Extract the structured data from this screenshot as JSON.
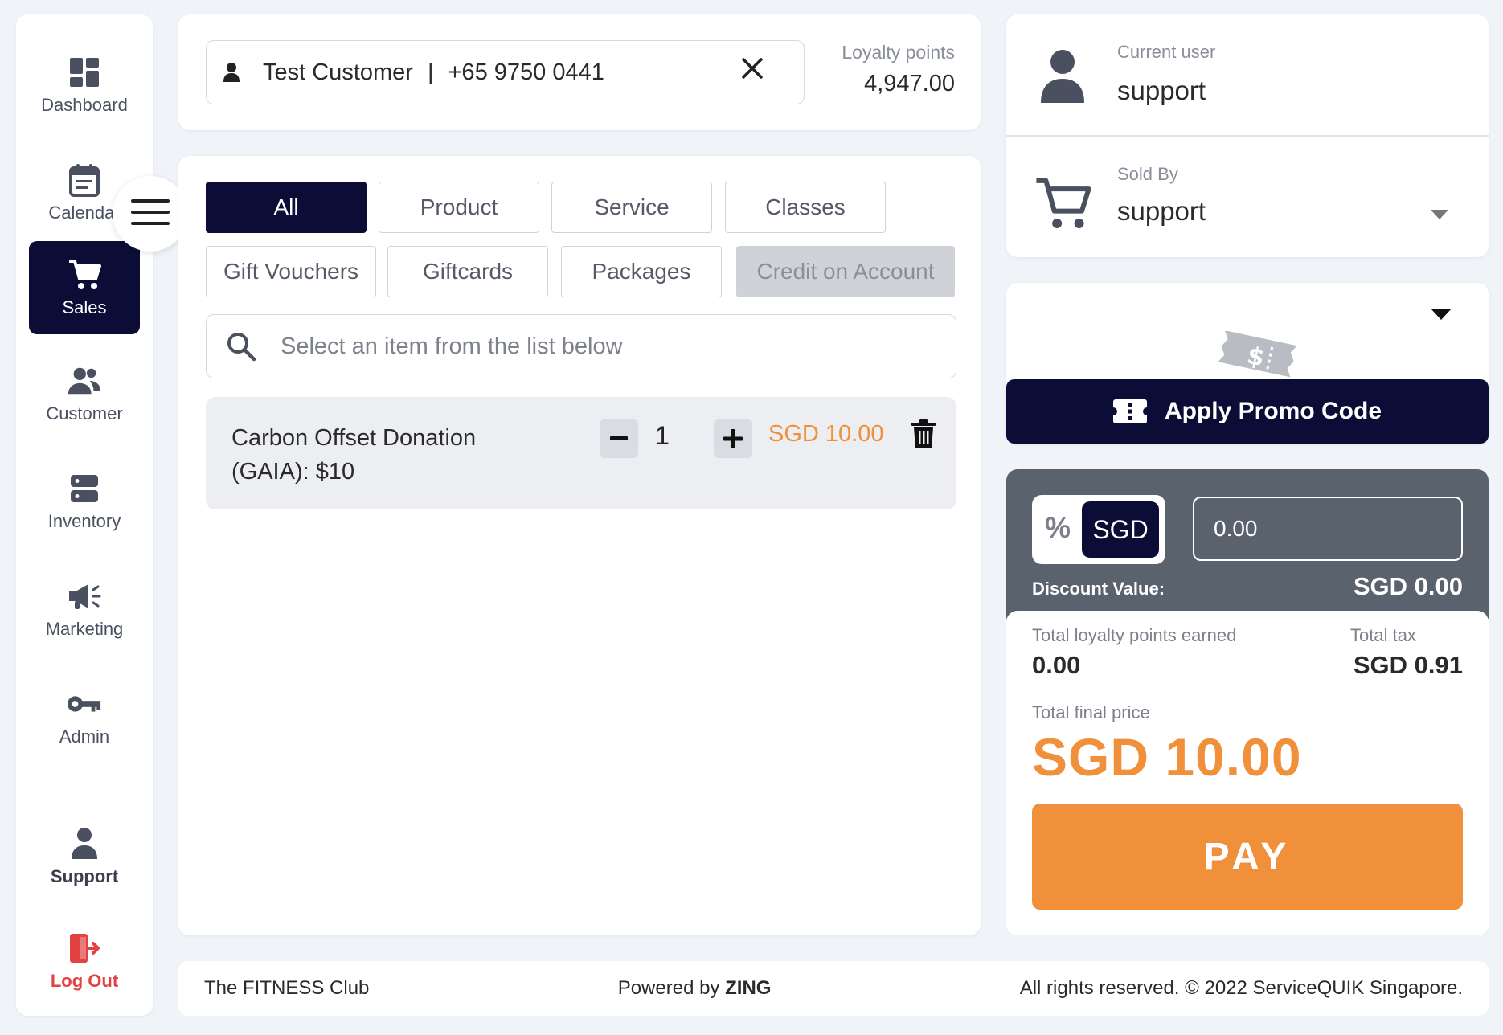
{
  "sidebar": {
    "items": [
      {
        "label": "Dashboard",
        "icon": "dashboard-icon"
      },
      {
        "label": "Calendar",
        "icon": "calendar-icon"
      },
      {
        "label": "Sales",
        "icon": "cart-icon"
      },
      {
        "label": "Customer",
        "icon": "users-icon"
      },
      {
        "label": "Inventory",
        "icon": "server-icon"
      },
      {
        "label": "Marketing",
        "icon": "megaphone-icon"
      },
      {
        "label": "Admin",
        "icon": "key-icon"
      }
    ],
    "support_label": "Support",
    "logout_label": "Log Out"
  },
  "customer": {
    "name": "Test Customer",
    "separator": "|",
    "phone": "+65 9750 0441",
    "loyalty_label": "Loyalty points",
    "loyalty_value": "4,947.00"
  },
  "tabs": [
    "All",
    "Product",
    "Service",
    "Classes",
    "Gift Vouchers",
    "Giftcards",
    "Packages",
    "Credit on Account"
  ],
  "search": {
    "placeholder": "Select an item from the list below"
  },
  "cart": {
    "item_name": "Carbon Offset Donation (GAIA): $10",
    "quantity": "1",
    "price": "SGD 10.00"
  },
  "user_panel": {
    "current_user_label": "Current user",
    "current_user": "support",
    "sold_by_label": "Sold By",
    "sold_by": "support"
  },
  "promo": {
    "button_label": "Apply Promo Code"
  },
  "summary": {
    "percent_symbol": "%",
    "currency_toggle": "SGD",
    "discount_input": "0.00",
    "discount_label": "Discount Value:",
    "discount_value": "SGD 0.00",
    "loyalty_earned_label": "Total loyalty points earned",
    "loyalty_earned": "0.00",
    "tax_label": "Total tax",
    "tax_value": "SGD 0.91",
    "final_label": "Total final price",
    "final_value": "SGD 10.00",
    "pay_label": "PAY"
  },
  "footer": {
    "club": "The FITNESS Club",
    "powered_prefix": "Powered by",
    "powered_brand": "ZING",
    "rights": "All rights reserved. © 2022 ServiceQUIK Singapore."
  },
  "colors": {
    "primary_dark": "#0b0d36",
    "accent_orange": "#f0903a",
    "discount_panel": "#5a626e",
    "logout_red": "#e34242"
  }
}
